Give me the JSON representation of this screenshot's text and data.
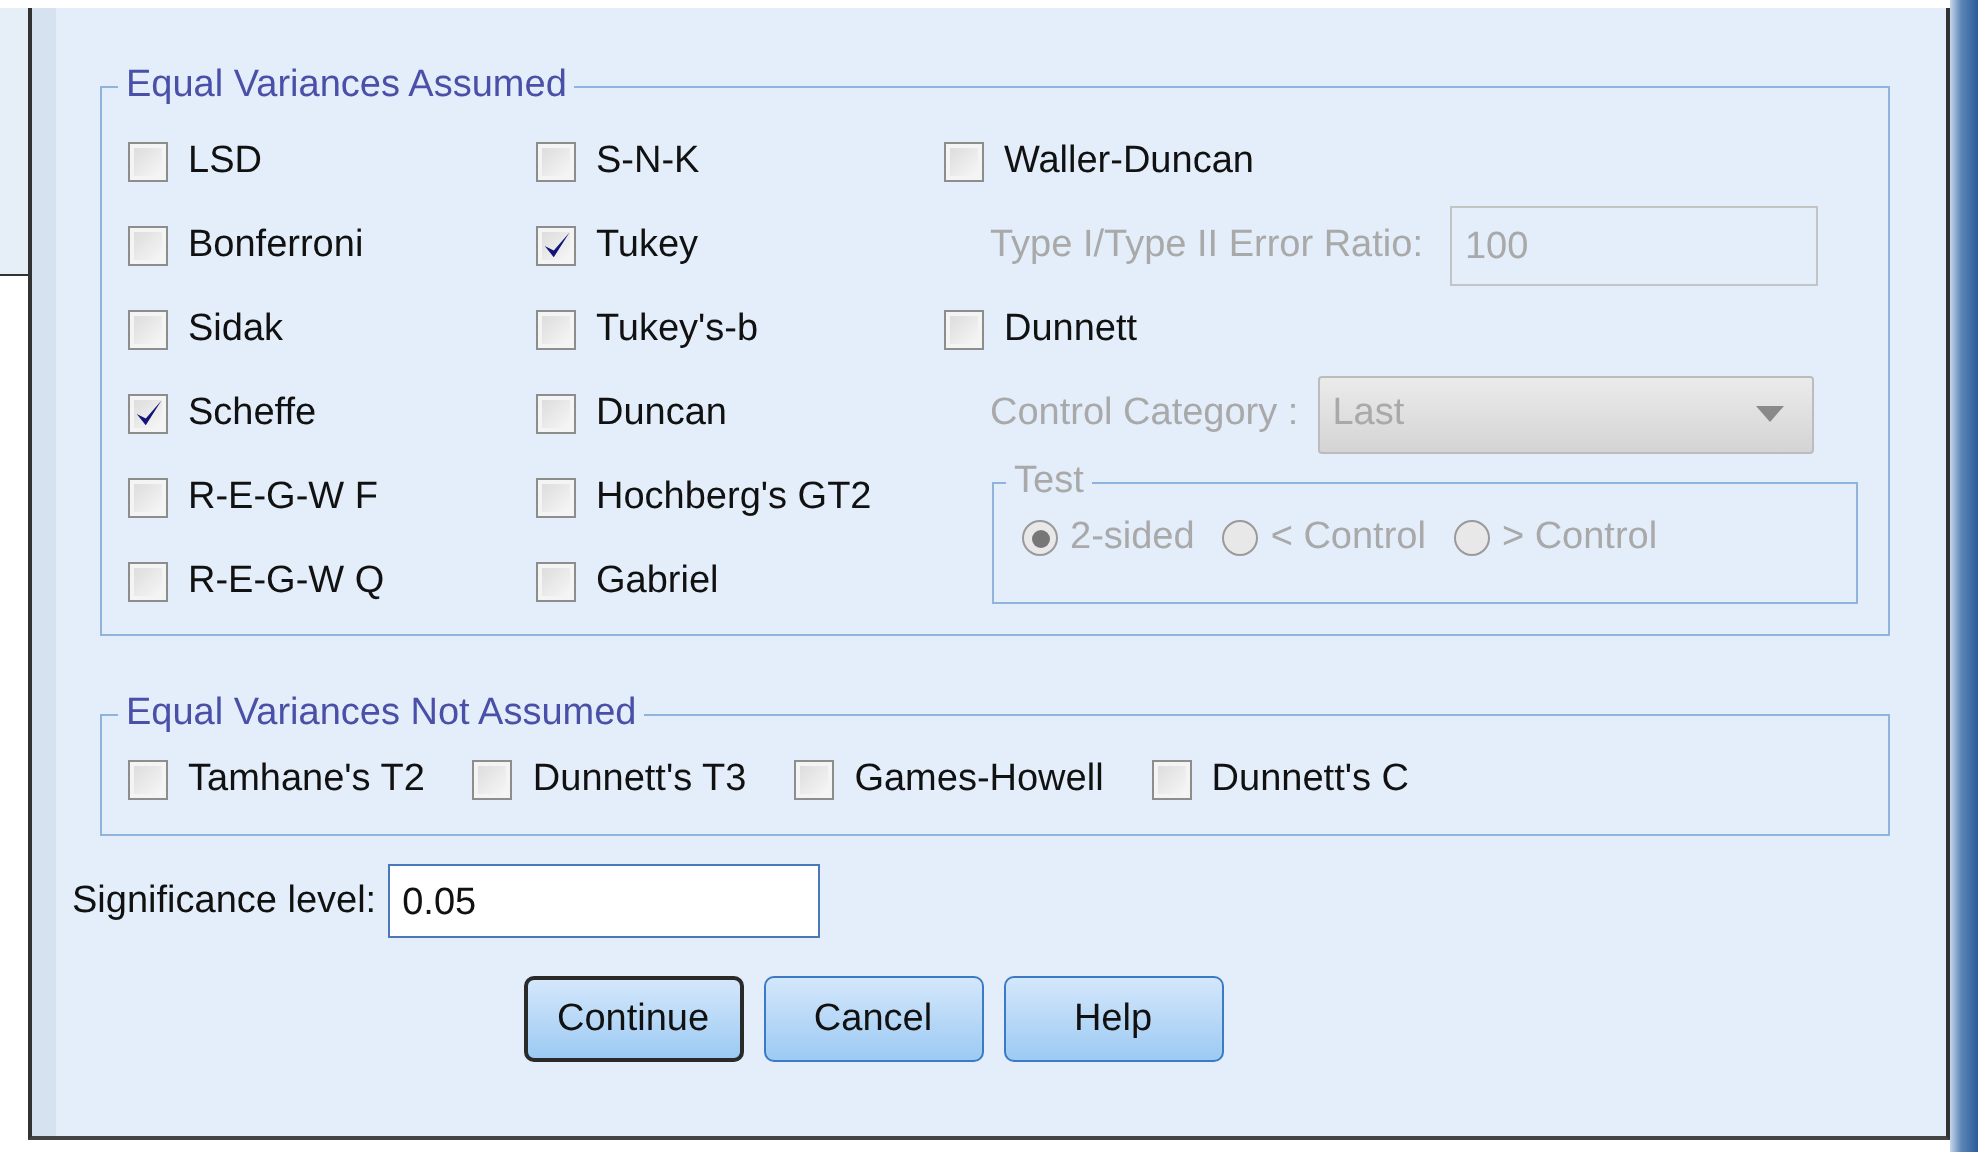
{
  "equal_variances_assumed": {
    "title": "Equal Variances Assumed",
    "tests": [
      {
        "label": "LSD",
        "checked": false
      },
      {
        "label": "Bonferroni",
        "checked": false
      },
      {
        "label": "Sidak",
        "checked": false
      },
      {
        "label": "Scheffe",
        "checked": true
      },
      {
        "label": "R-E-G-W F",
        "checked": false
      },
      {
        "label": "R-E-G-W Q",
        "checked": false
      },
      {
        "label": "S-N-K",
        "checked": false
      },
      {
        "label": "Tukey",
        "checked": true
      },
      {
        "label": "Tukey's-b",
        "checked": false
      },
      {
        "label": "Duncan",
        "checked": false
      },
      {
        "label": "Hochberg's GT2",
        "checked": false
      },
      {
        "label": "Gabriel",
        "checked": false
      }
    ],
    "waller_duncan": {
      "label": "Waller-Duncan",
      "checked": false
    },
    "error_ratio": {
      "label": "Type I/Type II Error Ratio:",
      "value": "100",
      "disabled": true
    },
    "dunnett": {
      "label": "Dunnett",
      "checked": false
    },
    "control_category": {
      "label": "Control Category :",
      "value": "Last",
      "disabled": true
    },
    "test": {
      "title": "Test",
      "disabled": true,
      "options": [
        {
          "label": "2-sided",
          "selected": true
        },
        {
          "label": "< Control",
          "selected": false
        },
        {
          "label": "> Control",
          "selected": false
        }
      ]
    }
  },
  "equal_variances_not_assumed": {
    "title": "Equal Variances Not Assumed",
    "tests": [
      {
        "label": "Tamhane's T2",
        "checked": false
      },
      {
        "label": "Dunnett's T3",
        "checked": false
      },
      {
        "label": "Games-Howell",
        "checked": false
      },
      {
        "label": "Dunnett's C",
        "checked": false
      }
    ]
  },
  "significance": {
    "label": "Significance level:",
    "value": "0.05"
  },
  "buttons": [
    {
      "label": "Continue",
      "default": true
    },
    {
      "label": "Cancel",
      "default": false
    },
    {
      "label": "Help",
      "default": false
    }
  ]
}
